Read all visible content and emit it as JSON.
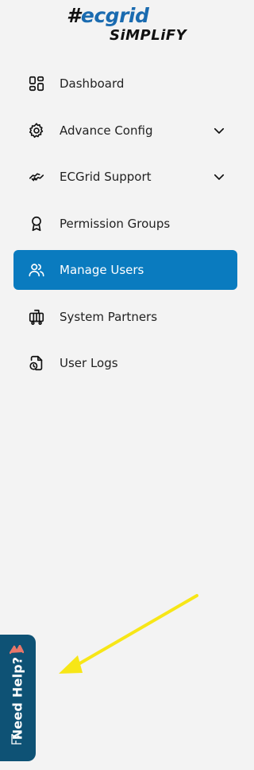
{
  "logo": {
    "top_hash": "#",
    "top_text": "ecgrid",
    "bottom_text": "SiMPLiFY"
  },
  "nav": {
    "items": [
      {
        "label": "Dashboard",
        "icon": "dashboard-icon",
        "has_chevron": false,
        "active": false
      },
      {
        "label": "Advance Config",
        "icon": "gear-icon",
        "has_chevron": true,
        "active": false
      },
      {
        "label": "ECGrid Support",
        "icon": "handshake-icon",
        "has_chevron": true,
        "active": false
      },
      {
        "label": "Permission Groups",
        "icon": "badge-icon",
        "has_chevron": false,
        "active": false
      },
      {
        "label": "Manage Users",
        "icon": "users-icon",
        "has_chevron": false,
        "active": true
      },
      {
        "label": "System Partners",
        "icon": "partners-icon",
        "has_chevron": false,
        "active": false
      },
      {
        "label": "User Logs",
        "icon": "logs-icon",
        "has_chevron": false,
        "active": false
      }
    ]
  },
  "help": {
    "label": "Need Help?"
  },
  "colors": {
    "background": "#f3f3f3",
    "active_bg": "#0a7bbf",
    "help_bg": "#0e5275",
    "logo_blue": "#1a6bb0",
    "annotation_arrow": "#f7e617"
  }
}
